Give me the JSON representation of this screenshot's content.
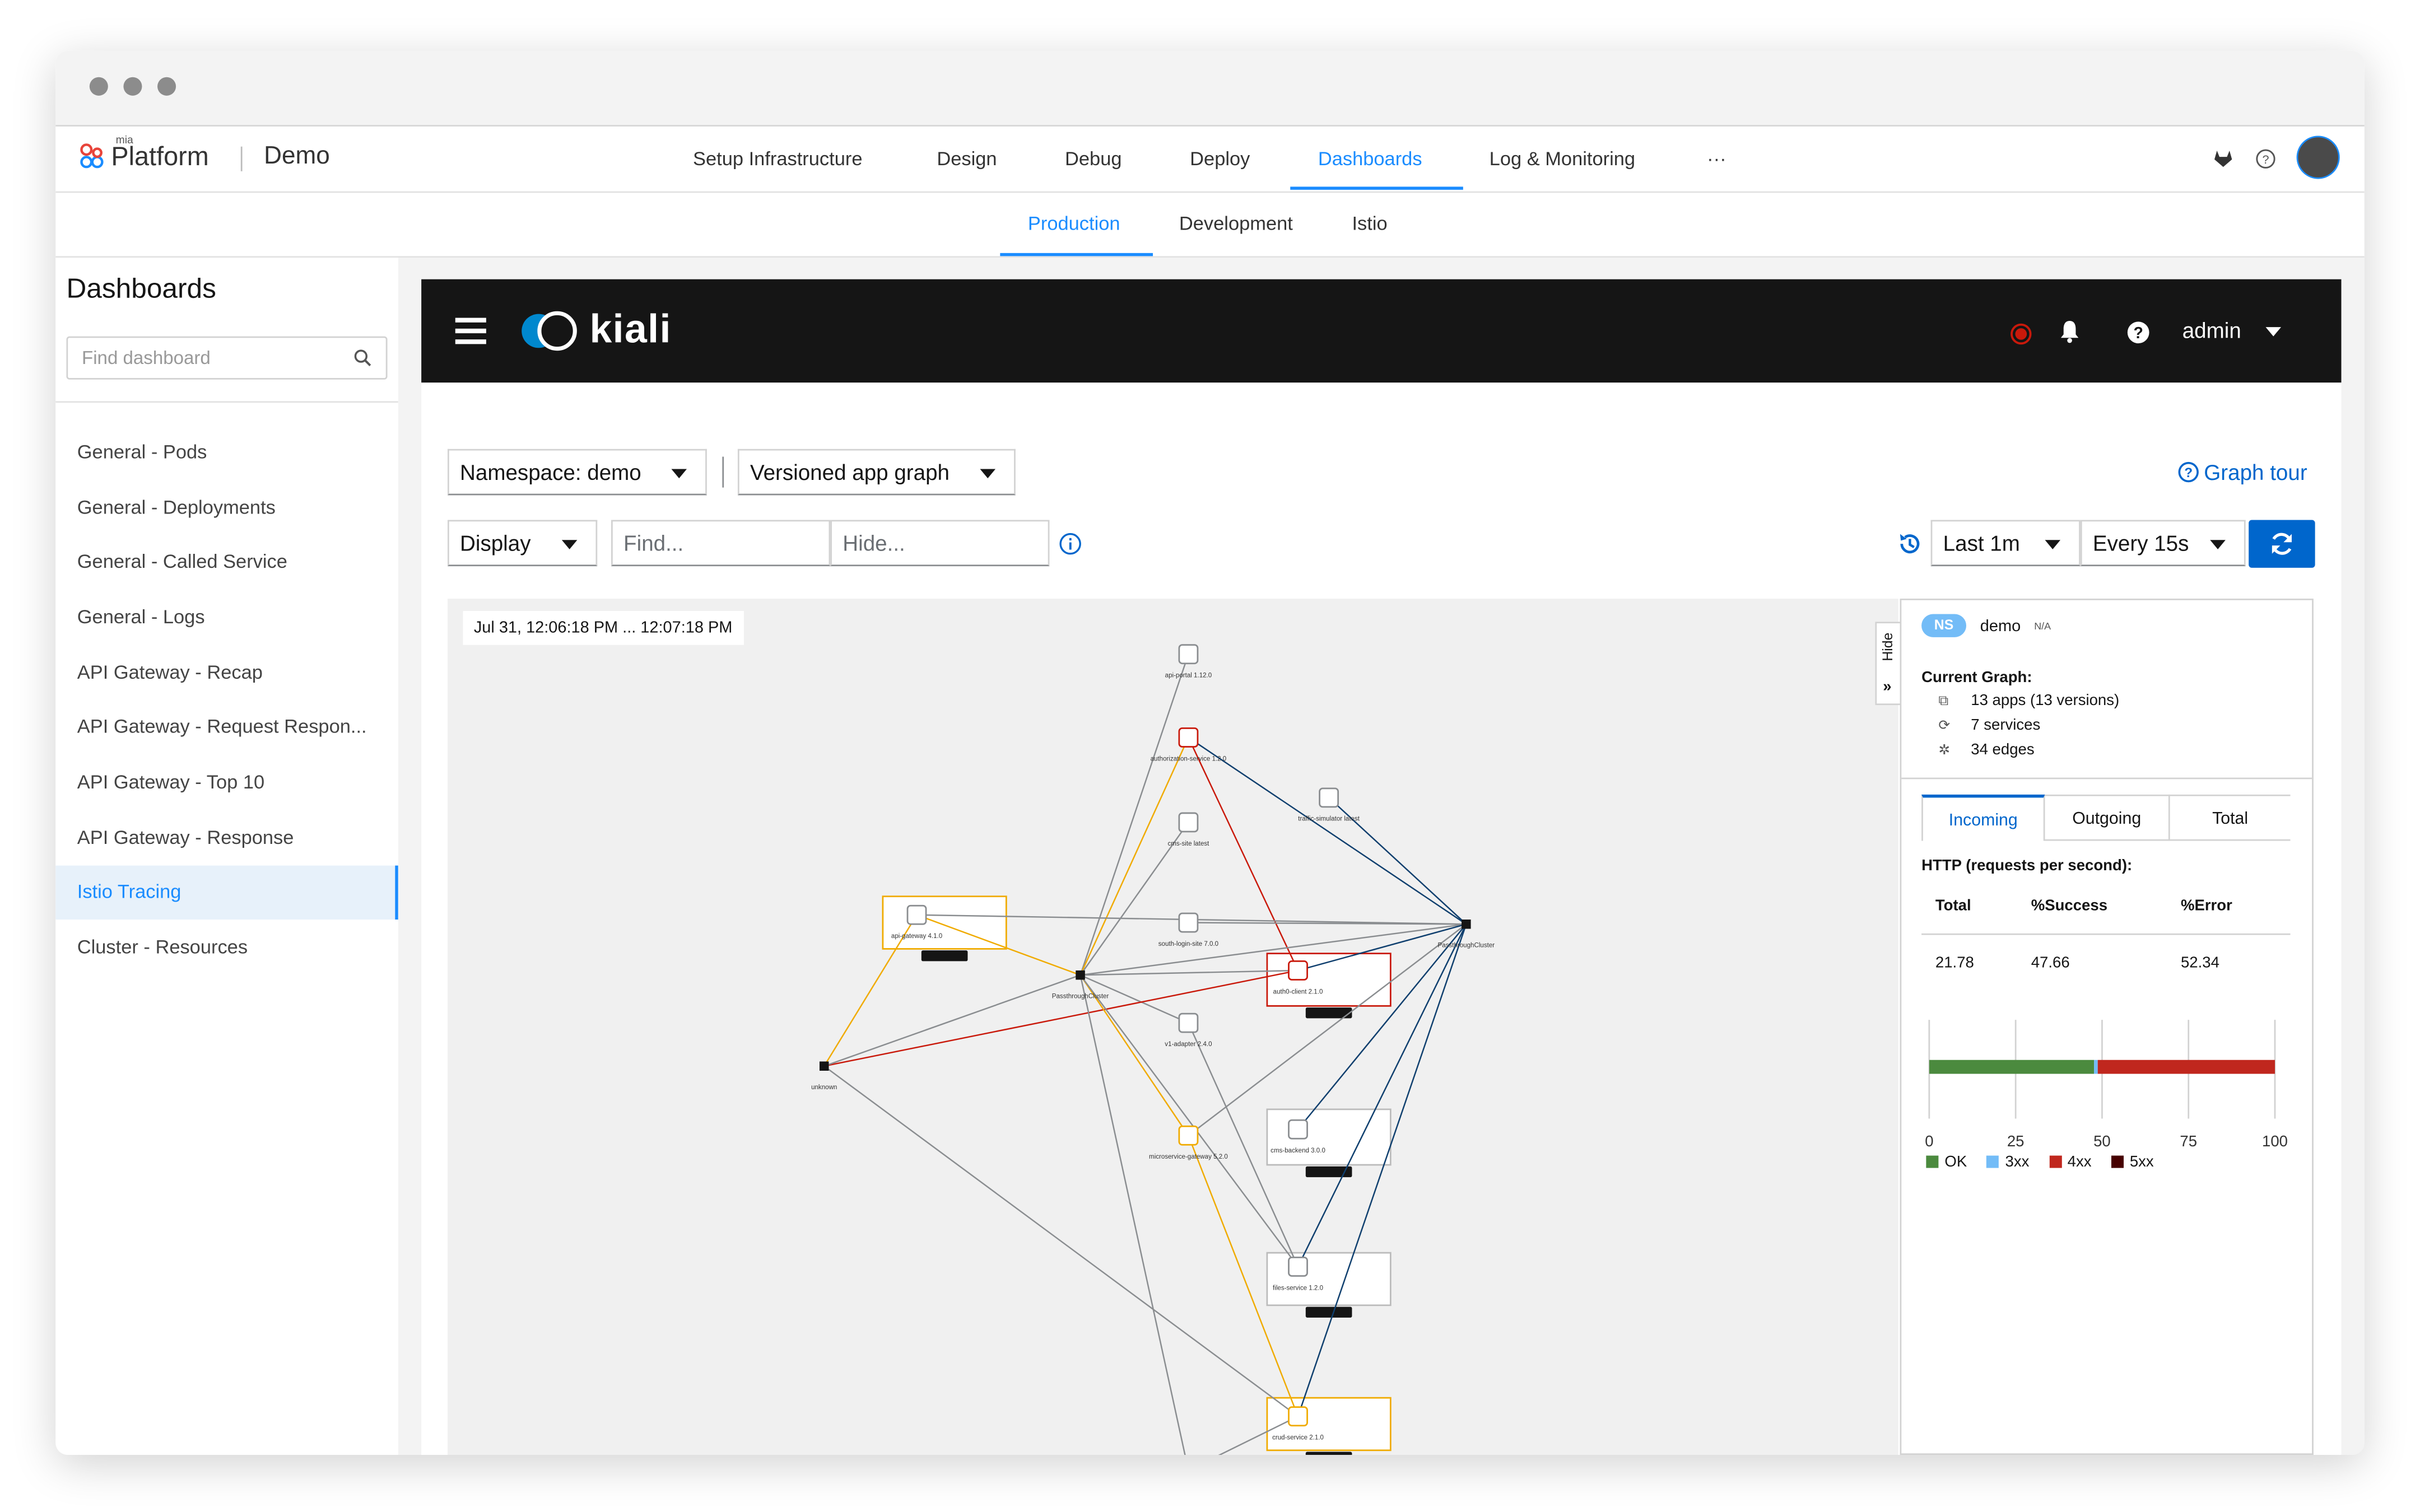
{
  "top_nav": {
    "brand_small": "mia",
    "brand": "Platform",
    "app_name": "Demo",
    "items": [
      "Setup Infrastructure",
      "Design",
      "Debug",
      "Deploy",
      "Dashboards",
      "Log & Monitoring",
      "···"
    ],
    "active": "Dashboards"
  },
  "sub_nav": {
    "items": [
      "Production",
      "Development",
      "Istio"
    ],
    "active": "Production"
  },
  "sidebar": {
    "title": "Dashboards",
    "search_placeholder": "Find dashboard",
    "items": [
      "General - Pods",
      "General - Deployments",
      "General - Called Service",
      "General - Logs",
      "API Gateway - Recap",
      "API Gateway - Request Respon...",
      "API Gateway - Top 10",
      "API Gateway - Response",
      "Istio Tracing",
      "Cluster - Resources"
    ],
    "active": "Istio Tracing"
  },
  "kiali": {
    "brand": "kiali",
    "user": "admin",
    "namespace_select": "Namespace: demo",
    "graph_type_select": "Versioned app graph",
    "display_select": "Display",
    "find_placeholder": "Find...",
    "hide_placeholder": "Hide...",
    "graph_tour": "Graph tour",
    "duration_select": "Last 1m",
    "refresh_select": "Every 15s",
    "timestamp": "Jul 31, 12:06:18 PM ... 12:07:18 PM",
    "hide_label": "Hide",
    "panel": {
      "ns_badge": "NS",
      "namespace": "demo",
      "ns_suffix": "N/A",
      "current_graph_label": "Current Graph:",
      "apps": "13 apps (13 versions)",
      "services": "7 services",
      "edges": "34 edges",
      "tabs": [
        "Incoming",
        "Outgoing",
        "Total"
      ],
      "active_tab": "Incoming",
      "http_label": "HTTP (requests per second):",
      "table_headers": [
        "Total",
        "%Success",
        "%Error"
      ],
      "table_values": [
        "21.78",
        "47.66",
        "52.34"
      ],
      "chart_ticks": [
        "0",
        "25",
        "50",
        "75",
        "100"
      ],
      "legend": [
        {
          "label": "OK",
          "color": "#4b8a3e"
        },
        {
          "label": "3xx",
          "color": "#73bcf7"
        },
        {
          "label": "4xx",
          "color": "#c0271e"
        },
        {
          "label": "5xx",
          "color": "#470000"
        }
      ]
    },
    "colors": {
      "accent": "#0066cc",
      "error_edge": "#c9190b",
      "warn_edge": "#f0ab00",
      "ok_edge": "#0f3f6e",
      "idle_edge": "#8a8d90"
    },
    "graph": {
      "nodes": [
        {
          "id": "api-portal",
          "label": "api-portal",
          "sub": "1.12.0"
        },
        {
          "id": "authorization-service",
          "label": "authorization-service",
          "sub": "1.2.0"
        },
        {
          "id": "traffic-simulator",
          "label": "traffic-simulator",
          "sub": "latest"
        },
        {
          "id": "cms-site",
          "label": "cms-site",
          "sub": "latest"
        },
        {
          "id": "api-gateway",
          "label": "api-gateway",
          "sub": "4.1.0",
          "group": "api-gateway"
        },
        {
          "id": "south-login-site",
          "label": "south-login-site",
          "sub": "7.0.0"
        },
        {
          "id": "passthrough-left",
          "label": "PassthroughCluster",
          "sub": ""
        },
        {
          "id": "auth0-client",
          "label": "auth0-client",
          "sub": "2.1.0",
          "group": "auth0-client"
        },
        {
          "id": "passthrough-right",
          "label": "PassthroughCluster",
          "sub": ""
        },
        {
          "id": "v1-adapter",
          "label": "v1-adapter",
          "sub": "2.4.0"
        },
        {
          "id": "unknown",
          "label": "unknown",
          "sub": ""
        },
        {
          "id": "microservice-gateway",
          "label": "microservice-gateway",
          "sub": "5.2.0"
        },
        {
          "id": "cms-backend",
          "label": "cms-backend",
          "sub": "3.0.0",
          "group": "cms-backend"
        },
        {
          "id": "files-service",
          "label": "files-service",
          "sub": "1.2.0",
          "group": "files-service"
        },
        {
          "id": "crud-service",
          "label": "crud-service",
          "sub": "2.1.0",
          "group": "crud-service"
        },
        {
          "id": "bottom",
          "label": "",
          "sub": ""
        }
      ]
    }
  }
}
